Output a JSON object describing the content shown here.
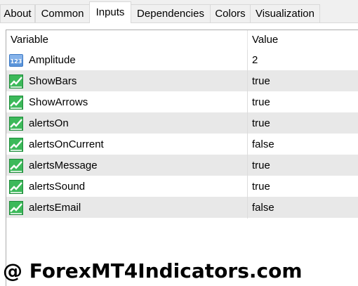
{
  "tabs": [
    {
      "label": "About",
      "active": false
    },
    {
      "label": "Common",
      "active": false
    },
    {
      "label": "Inputs",
      "active": true
    },
    {
      "label": "Dependencies",
      "active": false
    },
    {
      "label": "Colors",
      "active": false
    },
    {
      "label": "Visualization",
      "active": false
    }
  ],
  "table": {
    "columns": [
      "Variable",
      "Value"
    ],
    "rows": [
      {
        "icon": "integer-icon",
        "variable": "Amplitude",
        "value": "2"
      },
      {
        "icon": "bool-icon",
        "variable": "ShowBars",
        "value": "true"
      },
      {
        "icon": "bool-icon",
        "variable": "ShowArrows",
        "value": "true"
      },
      {
        "icon": "bool-icon",
        "variable": "alertsOn",
        "value": "true"
      },
      {
        "icon": "bool-icon",
        "variable": "alertsOnCurrent",
        "value": "false"
      },
      {
        "icon": "bool-icon",
        "variable": "alertsMessage",
        "value": "true"
      },
      {
        "icon": "bool-icon",
        "variable": "alertsSound",
        "value": "true"
      },
      {
        "icon": "bool-icon",
        "variable": "alertsEmail",
        "value": "false"
      }
    ]
  },
  "watermark": "@ ForexMT4Indicators.com",
  "colors": {
    "row_alt": "#e8e8e8",
    "bool_icon_green": "#2fa84f",
    "int_icon_blue": "#3b78c4"
  }
}
